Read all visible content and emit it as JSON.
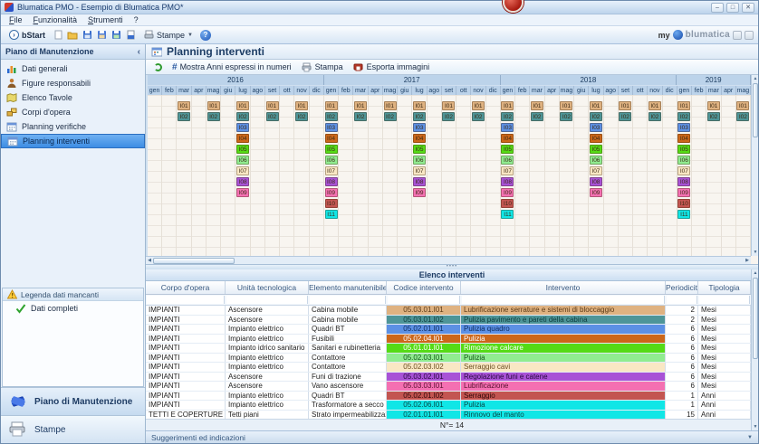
{
  "window": {
    "title": "Blumatica PMO - Esempio di Blumatica PMO*"
  },
  "menu": [
    "File",
    "Funzionalità",
    "Strumenti",
    "?"
  ],
  "toolbar": {
    "bstart": "bStart",
    "stampe": "Stampe",
    "brand_my": "my",
    "brand_name": "blumatica"
  },
  "sidebar": {
    "header": "Piano di Manutenzione",
    "items": [
      {
        "label": "Dati generali",
        "icon": "chart",
        "selected": false
      },
      {
        "label": "Figure responsabili",
        "icon": "person",
        "selected": false
      },
      {
        "label": "Elenco Tavole",
        "icon": "map",
        "selected": false
      },
      {
        "label": "Corpi d'opera",
        "icon": "boxes",
        "selected": false
      },
      {
        "label": "Planning verifiche",
        "icon": "calendar",
        "selected": false
      },
      {
        "label": "Planning interventi",
        "icon": "calendar",
        "selected": true
      }
    ],
    "legend": {
      "header": "Legenda dati mancanti",
      "items": [
        {
          "label": "Dati completi",
          "icon": "check"
        }
      ]
    },
    "sections": [
      {
        "label": "Piano di Manutenzione",
        "icon": "fan",
        "active": true
      },
      {
        "label": "Stampe",
        "icon": "printer",
        "active": false
      }
    ]
  },
  "main": {
    "title": "Planning interventi",
    "toolbar": {
      "mostra_anni": "Mostra Anni espressi in numeri",
      "stampa": "Stampa",
      "esporta": "Esporta immagini"
    }
  },
  "calendar": {
    "years": [
      {
        "label": "2016",
        "months": [
          "gen",
          "feb",
          "mar",
          "apr",
          "mag",
          "giu",
          "lug",
          "ago",
          "set",
          "ott",
          "nov",
          "dic"
        ]
      },
      {
        "label": "2017",
        "months": [
          "gen",
          "feb",
          "mar",
          "apr",
          "mag",
          "giu",
          "lug",
          "ago",
          "set",
          "ott",
          "nov",
          "dic"
        ]
      },
      {
        "label": "2018",
        "months": [
          "gen",
          "feb",
          "mar",
          "apr",
          "mag",
          "giu",
          "lug",
          "ago",
          "set",
          "ott",
          "nov",
          "dic"
        ]
      },
      {
        "label": "2019",
        "months": [
          "gen",
          "feb",
          "mar",
          "apr",
          "mag"
        ]
      }
    ],
    "columns": [
      [],
      [],
      [
        "I01",
        "I02"
      ],
      [],
      [
        "I01",
        "I02"
      ],
      [],
      [
        "I01",
        "I02",
        "I03",
        "I04",
        "I05",
        "I06",
        "I07",
        "I08",
        "I09"
      ],
      [],
      [
        "I01",
        "I02"
      ],
      [],
      [
        "I01",
        "I02"
      ],
      [],
      [
        "I01",
        "I02",
        "I03",
        "I04",
        "I05",
        "I06",
        "I07",
        "I08",
        "I09",
        "I10",
        "I11"
      ],
      [],
      [
        "I01",
        "I02"
      ],
      [],
      [
        "I01",
        "I02"
      ],
      [],
      [
        "I01",
        "I02",
        "I03",
        "I04",
        "I05",
        "I06",
        "I07",
        "I08",
        "I09"
      ],
      [],
      [
        "I01",
        "I02"
      ],
      [],
      [
        "I01",
        "I02"
      ],
      [],
      [
        "I01",
        "I02",
        "I03",
        "I04",
        "I05",
        "I06",
        "I07",
        "I08",
        "I09",
        "I10",
        "I11"
      ],
      [],
      [
        "I01",
        "I02"
      ],
      [],
      [
        "I01",
        "I02"
      ],
      [],
      [
        "I01",
        "I02",
        "I03",
        "I04",
        "I05",
        "I06",
        "I07",
        "I08",
        "I09"
      ],
      [],
      [
        "I01",
        "I02"
      ],
      [],
      [
        "I01",
        "I02"
      ],
      [],
      [
        "I01",
        "I02",
        "I03",
        "I04",
        "I05",
        "I06",
        "I07",
        "I08",
        "I09",
        "I10",
        "I11"
      ],
      [],
      [
        "I01",
        "I02"
      ],
      [],
      [
        "I01",
        "I02"
      ]
    ]
  },
  "interventions": {
    "I01": {
      "bg": "#dfb281",
      "fg": "#5b3a16"
    },
    "I02": {
      "bg": "#4e9598",
      "fg": "#0e3d3e"
    },
    "I03": {
      "bg": "#5c90e4",
      "fg": "#0e2d62"
    },
    "I04": {
      "bg": "#cc671a",
      "fg": "#ffffff"
    },
    "I05": {
      "bg": "#55db16",
      "fg": "#ffffff"
    },
    "I06": {
      "bg": "#90ec90",
      "fg": "#14551a"
    },
    "I07": {
      "bg": "#f9e7c4",
      "fg": "#6b4e22"
    },
    "I08": {
      "bg": "#a852d6",
      "fg": "#27083d"
    },
    "I09": {
      "bg": "#f470b2",
      "fg": "#57112f"
    },
    "I10": {
      "bg": "#c35551",
      "fg": "#2e0808"
    },
    "I11": {
      "bg": "#10e6e6",
      "fg": "#064646"
    },
    "I12": {
      "bg": "#10e6e6",
      "fg": "#064646"
    }
  },
  "table": {
    "title": "Elenco interventi",
    "columns": [
      "Corpo d'opera",
      "Unità tecnologica",
      "Elemento manutenibile",
      "Codice intervento",
      "Intervento",
      "Periodicità",
      "Tipologia"
    ],
    "rows": [
      {
        "id": "I01",
        "corpo": "IMPIANTI",
        "unita": "Ascensore",
        "elemento": "Cabina mobile",
        "codice": "05.03.01.I01",
        "intervento": "Lubrificazione serrature e sistemi di bloccaggio",
        "periodicita": "2",
        "tipologia": "Mesi"
      },
      {
        "id": "I02",
        "corpo": "IMPIANTI",
        "unita": "Ascensore",
        "elemento": "Cabina mobile",
        "codice": "05.03.01.I02",
        "intervento": "Pulizia pavimento e pareti della cabina",
        "periodicita": "2",
        "tipologia": "Mesi"
      },
      {
        "id": "I03",
        "corpo": "IMPIANTI",
        "unita": "Impianto elettrico",
        "elemento": "Quadri BT",
        "codice": "05.02.01.I01",
        "intervento": "Pulizia quadro",
        "periodicita": "6",
        "tipologia": "Mesi"
      },
      {
        "id": "I04",
        "corpo": "IMPIANTI",
        "unita": "Impianto elettrico",
        "elemento": "Fusibili",
        "codice": "05.02.04.I01",
        "intervento": "Pulizia",
        "periodicita": "6",
        "tipologia": "Mesi"
      },
      {
        "id": "I05",
        "corpo": "IMPIANTI",
        "unita": "Impianto idrico sanitario",
        "elemento": "Sanitari e rubinetteria",
        "codice": "05.01.01.I01",
        "intervento": "Rimozione calcare",
        "periodicita": "6",
        "tipologia": "Mesi"
      },
      {
        "id": "I06",
        "corpo": "IMPIANTI",
        "unita": "Impianto elettrico",
        "elemento": "Contattore",
        "codice": "05.02.03.I01",
        "intervento": "Pulizia",
        "periodicita": "6",
        "tipologia": "Mesi"
      },
      {
        "id": "I07",
        "corpo": "IMPIANTI",
        "unita": "Impianto elettrico",
        "elemento": "Contattore",
        "codice": "05.02.03.I02",
        "intervento": "Serraggio cavi",
        "periodicita": "6",
        "tipologia": "Mesi"
      },
      {
        "id": "I08",
        "corpo": "IMPIANTI",
        "unita": "Ascensore",
        "elemento": "Funi di trazione",
        "codice": "05.03.02.I01",
        "intervento": "Regolazione funi e catene",
        "periodicita": "6",
        "tipologia": "Mesi"
      },
      {
        "id": "I09",
        "corpo": "IMPIANTI",
        "unita": "Ascensore",
        "elemento": "Vano ascensore",
        "codice": "05.03.03.I01",
        "intervento": "Lubrificazione",
        "periodicita": "6",
        "tipologia": "Mesi"
      },
      {
        "id": "I10",
        "corpo": "IMPIANTI",
        "unita": "Impianto elettrico",
        "elemento": "Quadri BT",
        "codice": "05.02.01.I02",
        "intervento": "Serraggio",
        "periodicita": "1",
        "tipologia": "Anni"
      },
      {
        "id": "I11",
        "corpo": "IMPIANTI",
        "unita": "Impianto elettrico",
        "elemento": "Trasformatore a secco",
        "codice": "05.02.06.I01",
        "intervento": "Pulizia",
        "periodicita": "1",
        "tipologia": "Anni"
      },
      {
        "id": "I12",
        "corpo": "TETTI E COPERTURE",
        "unita": "Tetti piani",
        "elemento": "Strato impermeabilizzazione...",
        "codice": "02.01.01.I01",
        "intervento": "Rinnovo del manto",
        "periodicita": "15",
        "tipologia": "Anni"
      }
    ],
    "count_label": "N°= 14"
  },
  "statusbar": {
    "label": "Suggerimenti ed indicazioni"
  }
}
